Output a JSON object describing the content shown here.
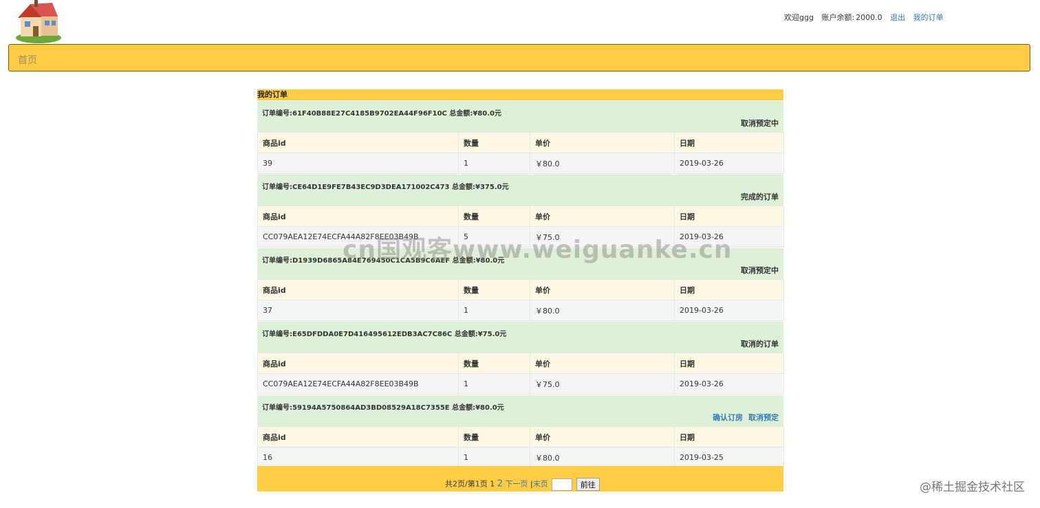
{
  "header": {
    "welcome": "欢迎ggg",
    "balance_label": "账户余额:",
    "balance_value": "2000.0",
    "logout": "退出",
    "my_orders": "我的订单"
  },
  "nav": {
    "home": "首页"
  },
  "panel_title": "我的订单",
  "orders": [
    {
      "info": "订单编号:61F40B88E27C4185B9702EA44F96F10C 总金额:¥80.0元",
      "status": "取消预定中",
      "headers": [
        "商品id",
        "数量",
        "单价",
        "日期"
      ],
      "row": [
        "39",
        "1",
        "￥80.0",
        "2019-03-26"
      ]
    },
    {
      "info": "订单编号:CE64D1E9FE7B43EC9D3DEA171002C473 总金额:¥375.0元",
      "status": "完成的订单",
      "headers": [
        "商品id",
        "数量",
        "单价",
        "日期"
      ],
      "row": [
        "CC079AEA12E74ECFA44A82F8EE03B49B",
        "5",
        "￥75.0",
        "2019-03-26"
      ]
    },
    {
      "info": "订单编号:D1939D6865A84E769450C1CA5B9C6AEF 总金额:¥80.0元",
      "status": "取消预定中",
      "headers": [
        "商品id",
        "数量",
        "单价",
        "日期"
      ],
      "row": [
        "37",
        "1",
        "￥80.0",
        "2019-03-26"
      ]
    },
    {
      "info": "订单编号:E65DFDDA0E7D416495612EDB3AC7C86C 总金额:¥75.0元",
      "status": "取消的订单",
      "headers": [
        "商品id",
        "数量",
        "单价",
        "日期"
      ],
      "row": [
        "CC079AEA12E74ECFA44A82F8EE03B49B",
        "1",
        "￥75.0",
        "2019-03-26"
      ]
    },
    {
      "info": "订单编号:59194A5750864AD3BD08529A18C7355E 总金额:¥80.0元",
      "confirm": "确认订房",
      "cancel": "取消预定",
      "headers": [
        "商品id",
        "数量",
        "单价",
        "日期"
      ],
      "row": [
        "16",
        "1",
        "￥80.0",
        "2019-03-25"
      ]
    }
  ],
  "pager": {
    "summary": "共2页/第1页",
    "current": "1",
    "page2": "2",
    "next": "下一页",
    "sep": "|",
    "last": "末页",
    "go": "前往"
  },
  "watermark": "cn国观客www.weiguanke.cn",
  "credit": "@稀土掘金技术社区",
  "colors": {
    "accent": "#ffcc44",
    "order_bg": "#dff0d8",
    "header_bg": "#fcf8e3",
    "link": "#337ab7"
  },
  "icons": {
    "logo": "house-logo-icon"
  }
}
